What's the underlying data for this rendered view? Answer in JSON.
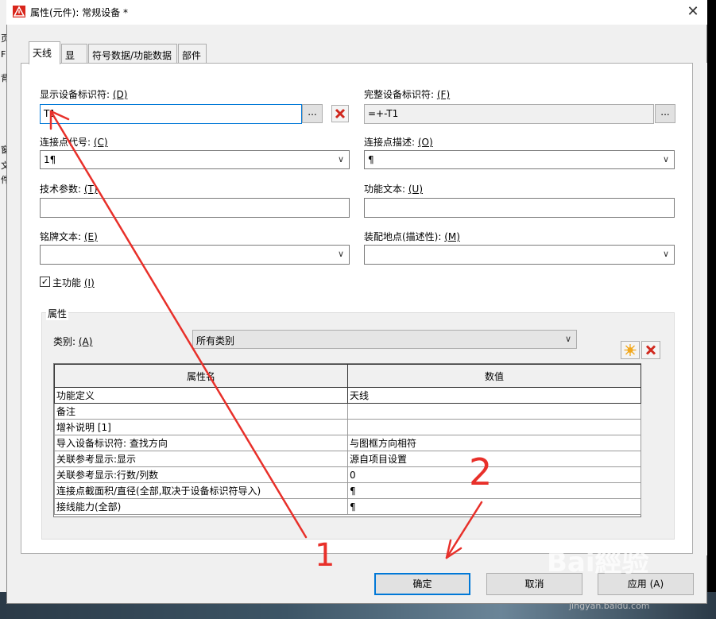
{
  "window": {
    "title": "属性(元件): 常规设备 *",
    "close_symbol": "✕"
  },
  "background": {
    "left_glyphs": [
      "页",
      "F",
      "背",
      "窗",
      "文",
      "件"
    ]
  },
  "tabs": [
    {
      "label": "天线",
      "active": true
    },
    {
      "label": "显示",
      "active": false
    },
    {
      "label": "符号数据/功能数据",
      "active": false
    },
    {
      "label": "部件",
      "active": false
    }
  ],
  "fields": {
    "display_dt": {
      "label": "显示设备标识符:",
      "key": "(D)",
      "value": "T1",
      "browse": "..."
    },
    "full_dt": {
      "label": "完整设备标识符:",
      "key": "(F)",
      "value": "=+-T1",
      "browse": "..."
    },
    "conn_designation": {
      "label": "连接点代号:",
      "key": "(C)",
      "value": "1¶"
    },
    "conn_description": {
      "label": "连接点描述:",
      "key": "(O)",
      "value": "¶"
    },
    "tech_params": {
      "label": "技术参数:",
      "key": "(T)",
      "value": ""
    },
    "function_text": {
      "label": "功能文本:",
      "key": "(U)",
      "value": ""
    },
    "nameplate_text": {
      "label": "铭牌文本:",
      "key": "(E)",
      "value": ""
    },
    "mount_location": {
      "label": "装配地点(描述性):",
      "key": "(M)",
      "value": ""
    },
    "main_function": {
      "label": "主功能",
      "key": "(I)",
      "checked": true
    }
  },
  "properties": {
    "group_title": "属性",
    "category_label": "类别:",
    "category_key": "(A)",
    "category_value": "所有类别",
    "columns": [
      "属性名",
      "数值"
    ],
    "rows": [
      {
        "name": "功能定义",
        "value": "天线"
      },
      {
        "name": "备注",
        "value": ""
      },
      {
        "name": "增补说明 [1]",
        "value": ""
      },
      {
        "name": "导入设备标识符: 查找方向",
        "value": "与图框方向相符"
      },
      {
        "name": "关联参考显示:显示",
        "value": "源自项目设置"
      },
      {
        "name": "关联参考显示:行数/列数",
        "value": "0"
      },
      {
        "name": "连接点截面积/直径(全部,取决于设备标识符导入)",
        "value": "¶"
      },
      {
        "name": "接线能力(全部)",
        "value": "¶"
      }
    ]
  },
  "buttons": {
    "ok": "确定",
    "cancel": "取消",
    "apply": "应用 (A)"
  },
  "annotations": {
    "mark1": "1",
    "mark2": "2",
    "arrow_color": "#e8302a"
  },
  "watermark": {
    "brand": "Bai經验",
    "url": "jingyan.baidu.com"
  }
}
